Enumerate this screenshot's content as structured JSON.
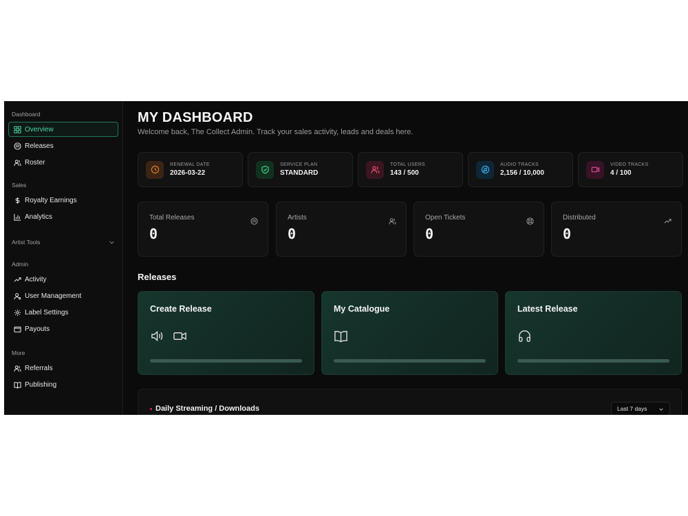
{
  "sidebar": {
    "sections": {
      "dashboard": "Dashboard",
      "sales": "Sales",
      "artist_tools": "Artist Tools",
      "admin": "Admin",
      "more": "More"
    },
    "items": {
      "overview": "Overview",
      "releases": "Releases",
      "roster": "Roster",
      "royalty_earnings": "Royalty Earnings",
      "analytics": "Analytics",
      "activity": "Activity",
      "user_management": "User Management",
      "label_settings": "Label Settings",
      "payouts": "Payouts",
      "referrals": "Referrals",
      "publishing": "Publishing"
    }
  },
  "header": {
    "title": "MY DASHBOARD",
    "subtitle": "Welcome back, The Collect Admin. Track your sales activity, leads and deals here."
  },
  "stats": [
    {
      "label": "RENEWAL DATE",
      "value": "2026-03-22",
      "icon": "clock-icon",
      "color": "#e07a2a"
    },
    {
      "label": "SERVICE PLAN",
      "value": "STANDARD",
      "icon": "shield-check-icon",
      "color": "#3ecf8e"
    },
    {
      "label": "TOTAL USERS",
      "value": "143 / 500",
      "icon": "users-icon",
      "color": "#e0506a"
    },
    {
      "label": "AUDIO TRACKS",
      "value": "2,156 / 10,000",
      "icon": "music-disc-icon",
      "color": "#3aa7e0"
    },
    {
      "label": "VIDEO TRACKS",
      "value": "4 / 100",
      "icon": "video-icon",
      "color": "#d8488e"
    }
  ],
  "metrics": [
    {
      "label": "Total Releases",
      "value": "0",
      "icon": "disc-icon"
    },
    {
      "label": "Artists",
      "value": "0",
      "icon": "users-icon"
    },
    {
      "label": "Open Tickets",
      "value": "0",
      "icon": "support-icon"
    },
    {
      "label": "Distributed",
      "value": "0",
      "icon": "trending-up-icon"
    }
  ],
  "releases": {
    "title": "Releases",
    "cards": [
      {
        "title": "Create Release"
      },
      {
        "title": "My Catalogue"
      },
      {
        "title": "Latest Release"
      }
    ]
  },
  "streaming": {
    "title": "Daily Streaming / Downloads",
    "range": "Last 7 days"
  },
  "colors": {
    "accent": "#3ecf8e",
    "background": "#0b0b0b"
  }
}
